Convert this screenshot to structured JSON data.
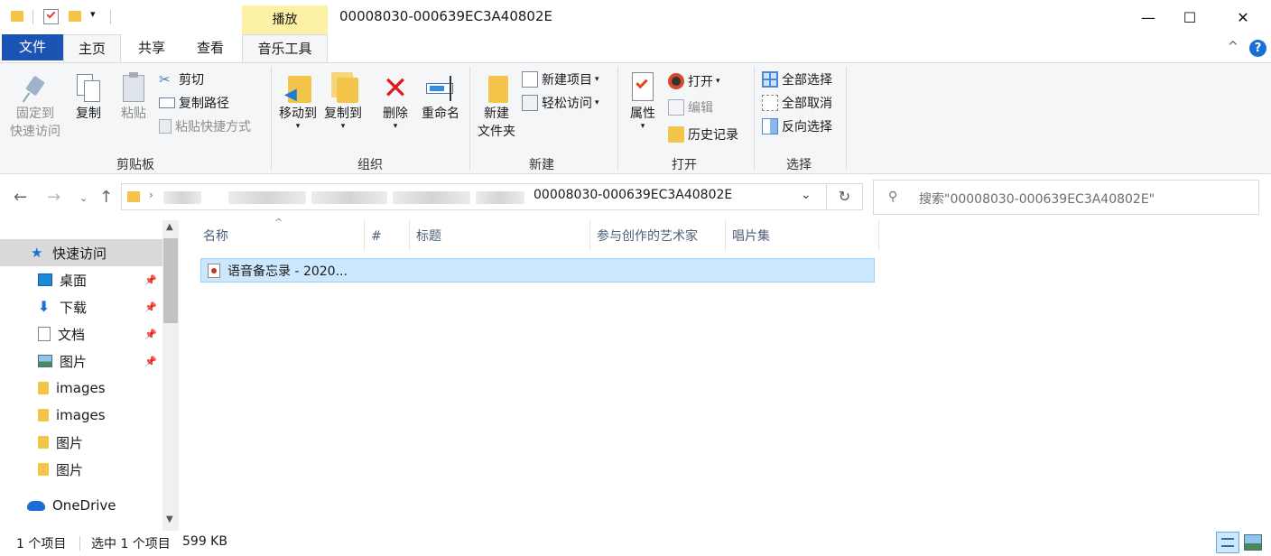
{
  "window": {
    "title": "00008030-000639EC3A40802E",
    "context_tab_header": "播放",
    "minimize": "—",
    "maximize": "☐",
    "close": "✕"
  },
  "tabs": {
    "file": "文件",
    "home": "主页",
    "share": "共享",
    "view": "查看",
    "music_tools": "音乐工具",
    "collapse": "^",
    "help": "?"
  },
  "ribbon": {
    "clipboard": {
      "label": "剪贴板",
      "pin_line1": "固定到",
      "pin_line2": "快速访问",
      "copy": "复制",
      "paste": "粘贴",
      "cut": "剪切",
      "copy_path": "复制路径",
      "paste_shortcut": "粘贴快捷方式"
    },
    "organize": {
      "label": "组织",
      "move_to": "移动到",
      "copy_to": "复制到",
      "delete": "删除",
      "rename": "重命名"
    },
    "new": {
      "label": "新建",
      "new_folder_line1": "新建",
      "new_folder_line2": "文件夹",
      "new_item": "新建项目",
      "easy_access": "轻松访问"
    },
    "open": {
      "label": "打开",
      "properties": "属性",
      "open": "打开",
      "edit": "编辑",
      "history": "历史记录"
    },
    "select": {
      "label": "选择",
      "select_all": "全部选择",
      "select_none": "全部取消",
      "invert": "反向选择"
    }
  },
  "address": {
    "current": "00008030-000639EC3A40802E",
    "search_placeholder": "搜索\"00008030-000639EC3A40802E\""
  },
  "columns": {
    "name": "名称",
    "number": "#",
    "title": "标题",
    "artists": "参与创作的艺术家",
    "album": "唱片集"
  },
  "files": [
    {
      "name": "语音备忘录 - 2020..."
    }
  ],
  "sidebar": {
    "quick_access": "快速访问",
    "items": [
      {
        "label": "桌面",
        "pinned": true,
        "icon": "desktop-icon"
      },
      {
        "label": "下载",
        "pinned": true,
        "icon": "download-icon"
      },
      {
        "label": "文档",
        "pinned": true,
        "icon": "document-icon"
      },
      {
        "label": "图片",
        "pinned": true,
        "icon": "pictures-icon"
      },
      {
        "label": "images",
        "pinned": false,
        "icon": "folder-icon"
      },
      {
        "label": "images",
        "pinned": false,
        "icon": "folder-icon"
      },
      {
        "label": "图片",
        "pinned": false,
        "icon": "folder-icon"
      },
      {
        "label": "图片",
        "pinned": false,
        "icon": "folder-icon"
      }
    ],
    "onedrive": "OneDrive"
  },
  "status": {
    "count": "1 个项目",
    "selected": "选中 1 个项目",
    "size": "599 KB"
  },
  "colors": {
    "file_tab": "#1a54b4",
    "context_tab": "#fdf1a5",
    "selection": "#cce8ff",
    "folder": "#f3c44a",
    "delete_red": "#d81e1e"
  }
}
